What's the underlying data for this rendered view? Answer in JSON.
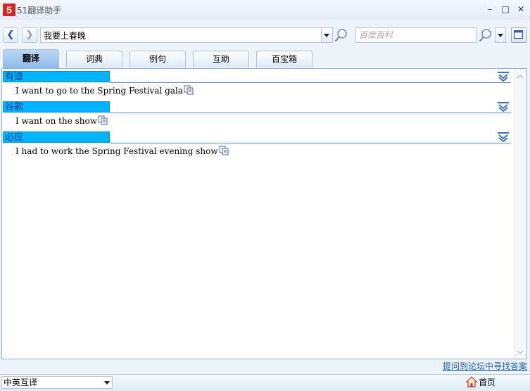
{
  "window": {
    "title": "51翻译助手",
    "logo_text": "5",
    "minimize_symbol": "–",
    "maximize_symbol": "□",
    "close_symbol": "✕"
  },
  "toolbar": {
    "back_symbol": "❮",
    "forward_symbol": "❯",
    "query_value": "我要上春晚",
    "baidu_placeholder": "百度百科"
  },
  "tabs": [
    {
      "label": "翻译",
      "active": true
    },
    {
      "label": "词典",
      "active": false
    },
    {
      "label": "例句",
      "active": false
    },
    {
      "label": "互助",
      "active": false
    },
    {
      "label": "百宝箱",
      "active": false
    }
  ],
  "results": [
    {
      "source": "有道",
      "translation": "I want to go to the Spring Festival gala"
    },
    {
      "source": "谷歌",
      "translation": "I want on the show"
    },
    {
      "source": "必应",
      "translation": "I had to work the Spring Festival evening show"
    }
  ],
  "footer": {
    "ask_forum_link": "提问到论坛中寻找答案",
    "language_mode": "中英互译",
    "home_label": "首页"
  },
  "colors": {
    "source_header_bg": "#00b4ff",
    "accent_line": "#5b8fd6",
    "logo_red": "#d8261c"
  }
}
